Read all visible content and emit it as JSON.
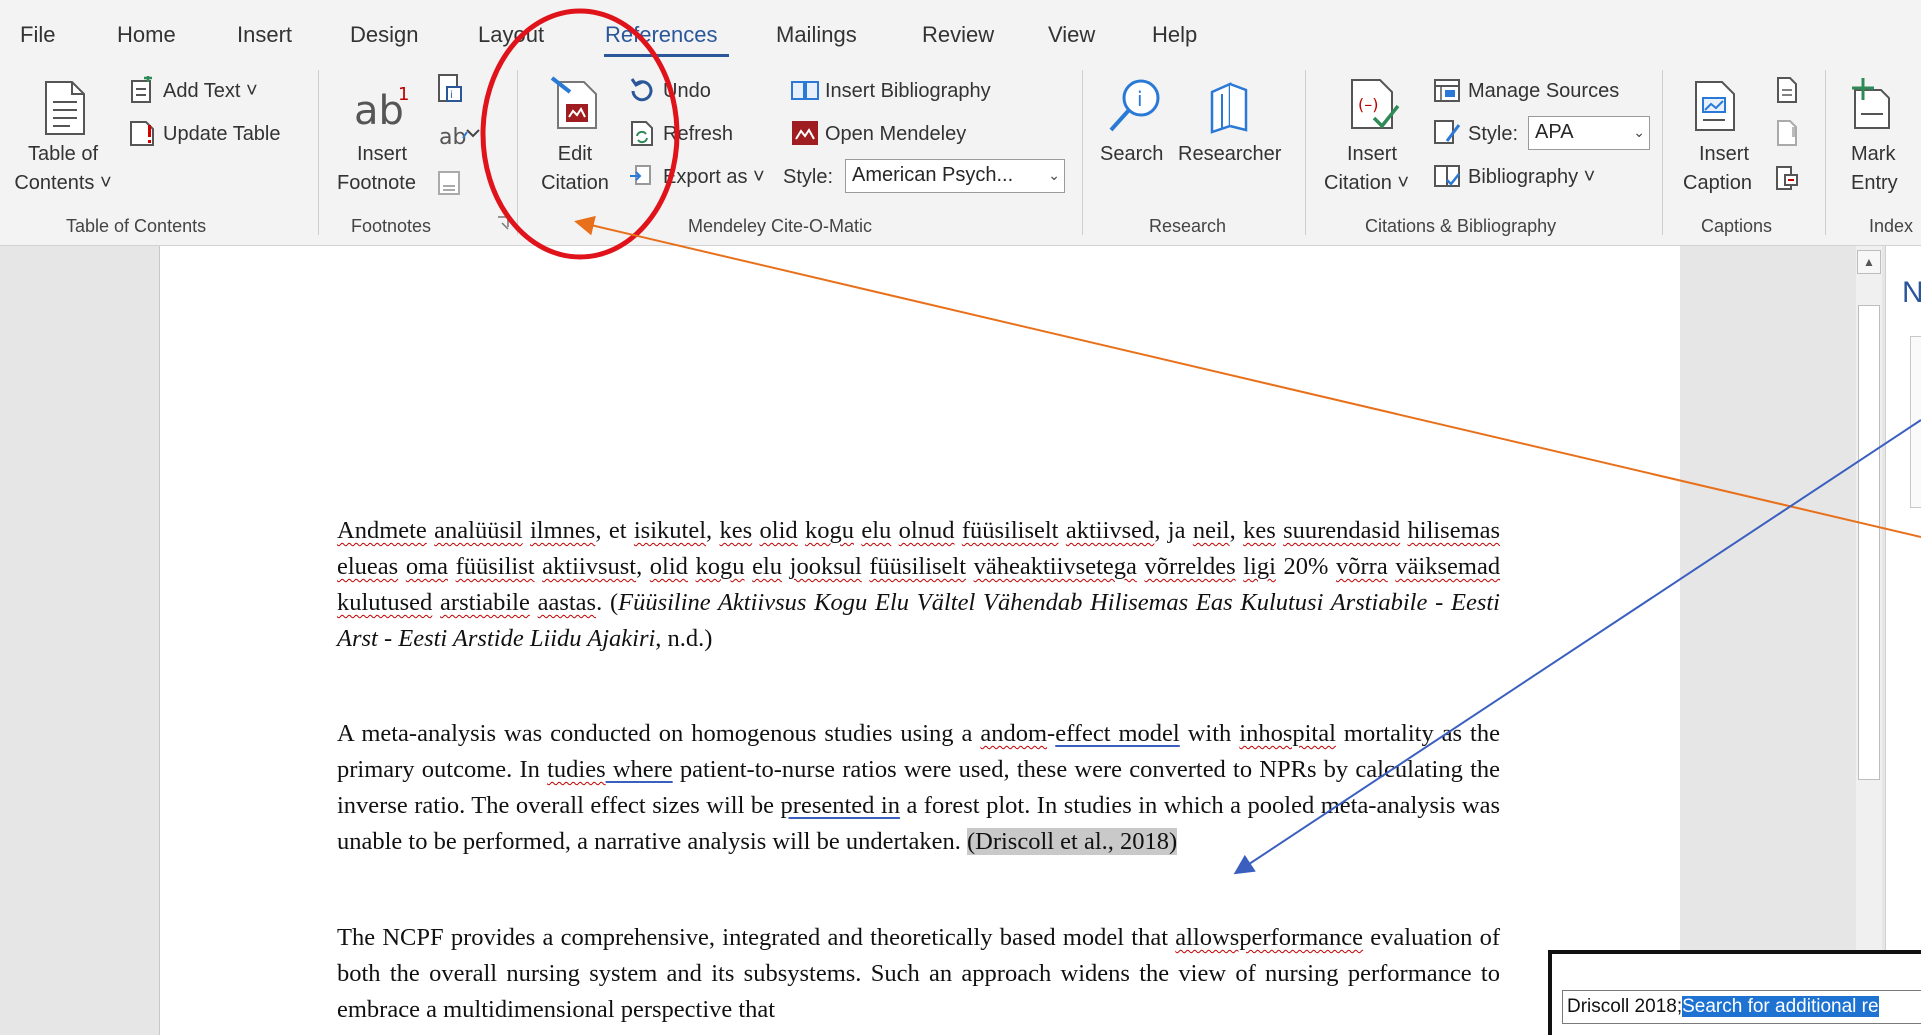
{
  "tabs": [
    "File",
    "Home",
    "Insert",
    "Design",
    "Layout",
    "References",
    "Mailings",
    "Review",
    "View",
    "Help"
  ],
  "active_tab": "References",
  "ribbon": {
    "toc": {
      "table_of_contents": "Table of",
      "table_of_contents_2": "Contents ˅",
      "add_text": "Add Text ˅",
      "update_table": "Update Table",
      "group": "Table of Contents"
    },
    "footnotes": {
      "insert_footnote": "Insert",
      "insert_footnote_2": "Footnote",
      "group": "Footnotes"
    },
    "mendeley": {
      "edit_citation": "Edit",
      "edit_citation_2": "Citation",
      "undo": "Undo",
      "refresh": "Refresh",
      "export_as": "Export as ˅",
      "insert_bibliography": "Insert Bibliography",
      "open_mendeley": "Open Mendeley",
      "style_label": "Style:",
      "style_value": "American Psych...",
      "group": "Mendeley Cite-O-Matic"
    },
    "research": {
      "search": "Search",
      "researcher": "Researcher",
      "group": "Research"
    },
    "citations": {
      "insert_citation": "Insert",
      "insert_citation_2": "Citation ˅",
      "manage_sources": "Manage Sources",
      "style_label": "Style:",
      "style_value": "APA",
      "bibliography": "Bibliography ˅",
      "group": "Citations & Bibliography"
    },
    "captions": {
      "insert_caption": "Insert",
      "insert_caption_2": "Caption",
      "group": "Captions"
    },
    "index": {
      "mark_entry": "Mark",
      "mark_entry_2": "Entry",
      "group": "Index"
    }
  },
  "document": {
    "p1": {
      "a": "Andmete",
      "b": " ",
      "c": "analüüsil",
      "d": " ",
      "e": "ilmnes",
      "f": ", et ",
      "g": "isikutel",
      "h": ", ",
      "i": "kes",
      "j": " ",
      "k": "olid",
      "l": " ",
      "m": "kogu",
      "n": " ",
      "o": "elu",
      "p": " ",
      "q": "olnud",
      "r": " ",
      "s": "füüsiliselt",
      "t": " ",
      "u": "aktiivsed",
      "v": ", ja ",
      "w": "neil",
      "x": ", ",
      "y": "kes",
      "z": " ",
      "aa": "suurendasid",
      "ab": " ",
      "ac": "hilisemas",
      "ad": " ",
      "ae": "elueas",
      "af": " ",
      "ag": "oma",
      "ah": " ",
      "ai": "füüsilist",
      "aj": " ",
      "ak": "aktiivsust",
      "al": ", ",
      "am": "olid",
      "an": " ",
      "ao": "kogu",
      "ap": " ",
      "aq": "elu",
      "ar": " ",
      "as": "jooksul",
      "at": " ",
      "au": "füüsiliselt",
      "av": " ",
      "aw": "väheaktiivsetega",
      "ax": " ",
      "ay": "võrreldes",
      "az": " ",
      "ba": "ligi",
      "bb": " 20% ",
      "bc": "võrra",
      "bd": " ",
      "be": "väiksemad",
      "bf": " ",
      "bg": "kulutused",
      "bh": " ",
      "bi": "arstiabile",
      "bj": " ",
      "bk": "aastas",
      "bl": ". (",
      "bm": "Füüsiline Aktiivsus Kogu Elu Vältel Vähendab Hilisemas Eas Kulutusi Arstiabile - Eesti Arst - Eesti Arstide Liidu Ajakiri",
      "bn": ", n.d.)"
    },
    "p2": {
      "a": "A meta-analysis was conducted on homogenous studies using a ",
      "b": "andom",
      "c": "-",
      "d": "effect  model",
      "e": "  with ",
      "f": "inhospital",
      "g": " mortality as the primary outcome. In ",
      "h": "tudies",
      "i": " where",
      "j": " patient-to-nurse ratios were used, these were converted to NPRs by calculating the inverse ratio. The overall effect sizes will be ",
      "k": "presented in",
      "l": " a forest plot. In studies in which a pooled meta-analysis was unable to be performed,  a narrative  analysis will be undertaken. ",
      "citation": "(Driscoll et al., 2018)"
    },
    "p3": {
      "a": "The NCPF provides a comprehensive, integrated and theoretically based model that ",
      "b": "allowsperformance",
      "c": " evaluation of both the overall nursing system and its subsystems. Such an approach widens the view of nursing performance to embrace a multidimensional perspective that"
    }
  },
  "popup": {
    "prefix": "Driscoll 2018;",
    "selected": "Search for additional re"
  },
  "right_pane_letter": "N",
  "colors": {
    "accent": "#2b579a",
    "annotation_circle": "#e0131b",
    "arrow_orange": "#e8701a",
    "arrow_blue": "#3a5fbf",
    "mendeley_red": "#9f1d20"
  }
}
